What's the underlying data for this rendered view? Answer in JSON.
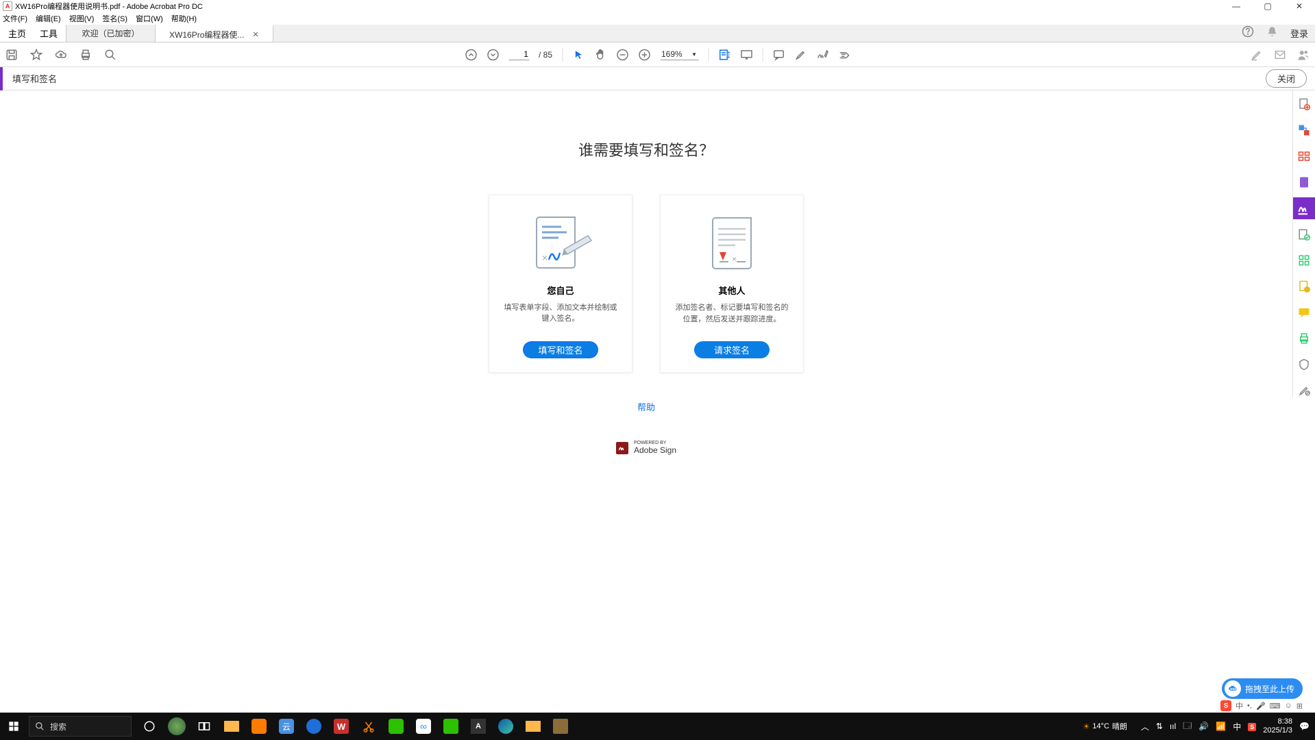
{
  "window": {
    "title": "XW16Pro编程器使用说明书.pdf - Adobe Acrobat Pro DC"
  },
  "menu": {
    "file": "文件(F)",
    "edit": "编辑(E)",
    "view": "视图(V)",
    "sign": "签名(S)",
    "window": "窗口(W)",
    "help": "帮助(H)"
  },
  "tabs": {
    "home": "主页",
    "tools": "工具",
    "welcome": "欢迎（已加密）",
    "doc": "XW16Pro编程器使...",
    "login": "登录"
  },
  "toolbar": {
    "page_current": "1",
    "page_total": "/ 85",
    "zoom": "169%"
  },
  "fillsign": {
    "title": "填写和签名",
    "close": "关闭"
  },
  "main": {
    "question": "谁需要填写和签名？",
    "card_self_title": "您自己",
    "card_self_desc": "填写表单字段、添加文本并绘制或键入签名。",
    "card_self_btn": "填写和签名",
    "card_others_title": "其他人",
    "card_others_desc": "添加签名者、标记要填写和签名的位置，然后发送并跟踪进度。",
    "card_others_btn": "请求签名",
    "help": "帮助",
    "powered_small": "POWERED BY",
    "powered_brand": "Adobe Sign"
  },
  "upload_pill": "拖拽至此上传",
  "ime": {
    "lang": "中"
  },
  "taskbar": {
    "search": "搜索",
    "weather_temp": "14°C",
    "weather_text": "晴朗",
    "ime": "中",
    "time": "8:38",
    "date": "2025/1/3"
  }
}
